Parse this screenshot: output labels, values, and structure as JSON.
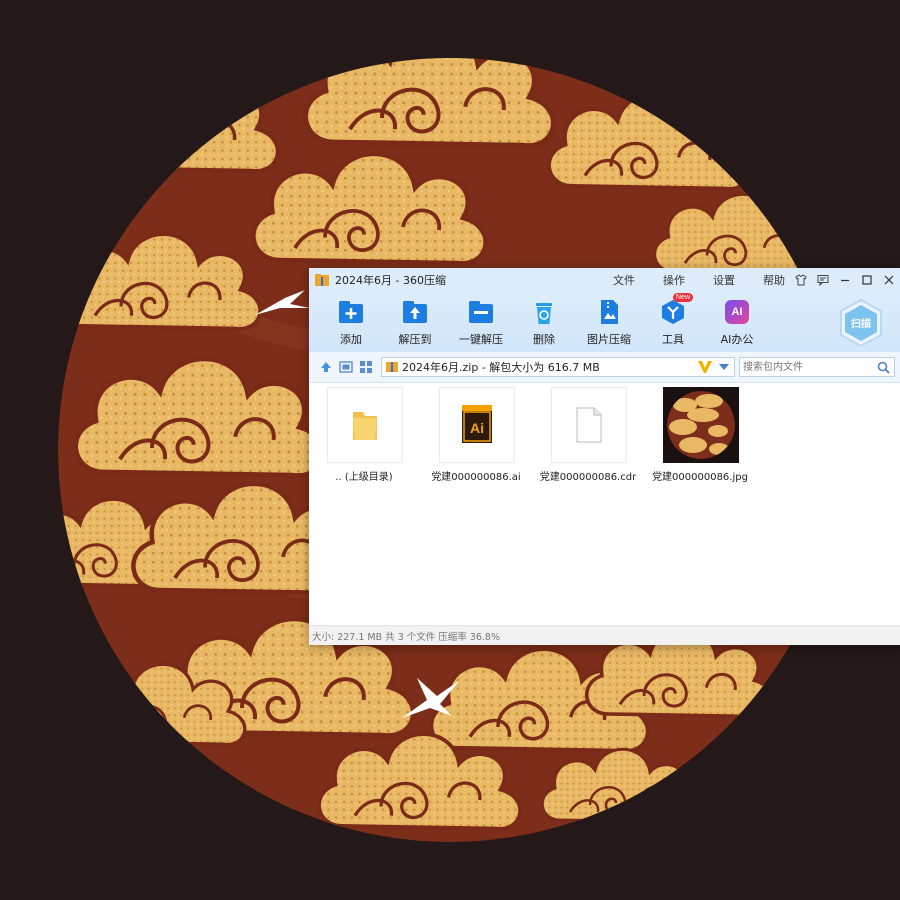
{
  "window": {
    "title": "2024年6月 - 360压缩",
    "menu": [
      "文件",
      "操作",
      "设置",
      "帮助"
    ]
  },
  "toolbar": {
    "buttons": [
      {
        "label": "添加",
        "icon": "add-icon"
      },
      {
        "label": "解压到",
        "icon": "extract-to-icon"
      },
      {
        "label": "一键解压",
        "icon": "one-click-extract-icon"
      },
      {
        "label": "删除",
        "icon": "delete-icon"
      },
      {
        "label": "图片压缩",
        "icon": "image-compress-icon"
      },
      {
        "label": "工具",
        "icon": "tools-icon",
        "badge": "New"
      },
      {
        "label": "AI办公",
        "icon": "ai-office-icon",
        "icon_text": "AI"
      }
    ],
    "scan_label": "扫描"
  },
  "address": {
    "path": "2024年6月.zip - 解包大小为 616.7 MB",
    "search_placeholder": "搜索包内文件"
  },
  "files": [
    {
      "name": ".. (上级目录)",
      "type": "parent-folder"
    },
    {
      "name": "党建000000086.ai",
      "type": "ai",
      "icon_text": "Ai"
    },
    {
      "name": "党建000000086.cdr",
      "type": "cdr"
    },
    {
      "name": "党建000000086.jpg",
      "type": "jpg"
    }
  ],
  "status": "大小: 227.1 MB 共 3 个文件 压缩率 36.8%",
  "colors": {
    "background": "#241818",
    "cloud_gold": "#e8b864",
    "cloud_outline": "#7a2a16",
    "disc_red": "#7c2e1a",
    "titlebar": "#dcecfb",
    "accent_blue": "#2f8ce6"
  }
}
